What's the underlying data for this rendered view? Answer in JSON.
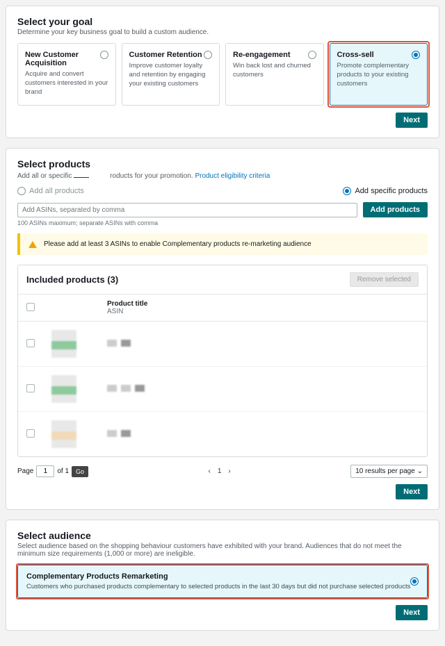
{
  "goal": {
    "title": "Select your goal",
    "sub": "Determine your key business goal to build a custom audience.",
    "cards": [
      {
        "title": "New Customer Acquisition",
        "desc": "Acquire and convert customers interested in your brand",
        "selected": false
      },
      {
        "title": "Customer Retention",
        "desc": "Improve customer loyalty and retention by engaging your existing customers",
        "selected": false
      },
      {
        "title": "Re-engagement",
        "desc": "Win back lost and churned customers",
        "selected": false
      },
      {
        "title": "Cross-sell",
        "desc": "Promote complementary products to your existing customers",
        "selected": true
      }
    ],
    "next": "Next"
  },
  "products": {
    "title": "Select products",
    "sub_prefix": "Add all or specific",
    "sub_suffix": "roducts for your promotion.",
    "link": "Product eligibility criteria",
    "opt_all": "Add all products",
    "opt_specific": "Add specific products",
    "input_placeholder": "Add ASINs, separated by comma",
    "add_btn": "Add products",
    "hint": "100 ASINs maximum; separate ASINs with comma",
    "alert": "Please add at least 3 ASINs to enable Complementary products re-marketing audience",
    "table_title": "Included products (3)",
    "remove_btn": "Remove selected",
    "col_title": "Product title",
    "col_sub": "ASIN",
    "page_label": "Page",
    "page_value": "1",
    "of_label": "of 1",
    "go": "Go",
    "page_num": "1",
    "results": "10 results per page",
    "next": "Next"
  },
  "audience": {
    "title": "Select audience",
    "sub": "Select audience based on the shopping behaviour customers have exhibited with your brand. Audiences that do not meet the minimum size requirements (1,000 or more) are ineligible.",
    "card_title": "Complementary Products Remarketing",
    "card_desc": "Customers who purchased products complementary to selected products in the last 30 days but did not purchase selected products",
    "next": "Next"
  }
}
